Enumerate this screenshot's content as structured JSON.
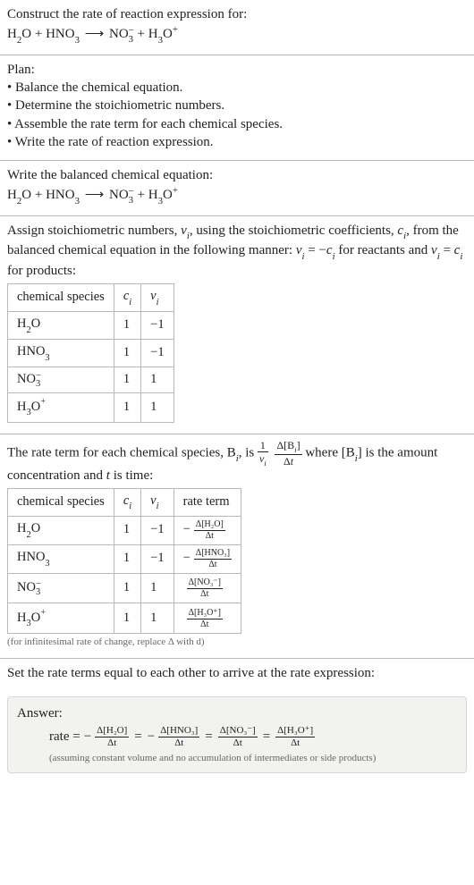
{
  "chart_data": [
    {
      "type": "table",
      "title": "Stoichiometric numbers",
      "columns": [
        "chemical species",
        "c_i",
        "ν_i"
      ],
      "rows": [
        [
          "H₂O",
          1,
          -1
        ],
        [
          "HNO₃",
          1,
          -1
        ],
        [
          "NO₃⁻",
          1,
          1
        ],
        [
          "H₃O⁺",
          1,
          1
        ]
      ]
    },
    {
      "type": "table",
      "title": "Rate terms",
      "columns": [
        "chemical species",
        "c_i",
        "ν_i",
        "rate term"
      ],
      "rows": [
        [
          "H₂O",
          1,
          -1,
          "−Δ[H₂O]/Δt"
        ],
        [
          "HNO₃",
          1,
          -1,
          "−Δ[HNO₃]/Δt"
        ],
        [
          "NO₃⁻",
          1,
          1,
          "Δ[NO₃⁻]/Δt"
        ],
        [
          "H₃O⁺",
          1,
          1,
          "Δ[H₃O⁺]/Δt"
        ]
      ]
    }
  ],
  "prompt": {
    "title": "Construct the rate of reaction expression for:"
  },
  "eq_parts": {
    "h2o": "H",
    "h2o_sub": "2",
    "h2o_o": "O",
    "plus": " + ",
    "hno3": "HNO",
    "hno3_sub": "3",
    "arrow": "⟶",
    "no3": "NO",
    "no3_sub": "3",
    "no3_sup": "−",
    "h3o": "H",
    "h3o_sub": "3",
    "h3o_o": "O",
    "h3o_sup": "+"
  },
  "plan": {
    "title": "Plan:",
    "b1": "• Balance the chemical equation.",
    "b2": "• Determine the stoichiometric numbers.",
    "b3": "• Assemble the rate term for each chemical species.",
    "b4": "• Write the rate of reaction expression."
  },
  "balanced": {
    "title": "Write the balanced chemical equation:"
  },
  "stoich": {
    "text_a": "Assign stoichiometric numbers, ",
    "nu_i": "ν",
    "nu_sub": "i",
    "text_b": ", using the stoichiometric coefficients, ",
    "c_i": "c",
    "c_sub": "i",
    "text_c": ", from the balanced chemical equation in the following manner: ",
    "rel1_a": "ν",
    "rel1_b": " = −",
    "rel1_c": "c",
    "text_d": " for reactants and ",
    "rel2_a": "ν",
    "rel2_b": " = ",
    "rel2_c": "c",
    "text_e": " for products:"
  },
  "table1": {
    "h1": "chemical species",
    "h2_a": "c",
    "h2_b": "i",
    "h3_a": "ν",
    "h3_b": "i",
    "r1": {
      "c": "1",
      "v": "−1"
    },
    "r2": {
      "c": "1",
      "v": "−1"
    },
    "r3": {
      "c": "1",
      "v": "1"
    },
    "r4": {
      "c": "1",
      "v": "1"
    }
  },
  "rateterm": {
    "text_a": "The rate term for each chemical species, B",
    "i": "i",
    "text_b": ", is ",
    "one": "1",
    "nu": "ν",
    "dB": "Δ[B",
    "dB2": "]",
    "dt": "Δt",
    "text_c": " where [B",
    "text_d": "] is the amount concentration and ",
    "t": "t",
    "text_e": " is time:"
  },
  "table2": {
    "h1": "chemical species",
    "h2_a": "c",
    "h2_b": "i",
    "h3_a": "ν",
    "h3_b": "i",
    "h4": "rate term",
    "r1": {
      "c": "1",
      "v": "−1",
      "num": "Δ[H₂O]",
      "den": "Δt",
      "neg": "− "
    },
    "r2": {
      "c": "1",
      "v": "−1",
      "num": "Δ[HNO₃]",
      "den": "Δt",
      "neg": "− "
    },
    "r3": {
      "c": "1",
      "v": "1",
      "num": "Δ[NO₃⁻]",
      "den": "Δt",
      "neg": ""
    },
    "r4": {
      "c": "1",
      "v": "1",
      "num": "Δ[H₃O⁺]",
      "den": "Δt",
      "neg": ""
    },
    "footnote": "(for infinitesimal rate of change, replace Δ with d)"
  },
  "final": {
    "title": "Set the rate terms equal to each other to arrive at the rate expression:"
  },
  "answer": {
    "title": "Answer:",
    "rate": "rate = ",
    "neg": "− ",
    "eq": " = ",
    "t1n": "Δ[H₂O]",
    "t1d": "Δt",
    "t2n": "Δ[HNO₃]",
    "t2d": "Δt",
    "t3n": "Δ[NO₃⁻]",
    "t3d": "Δt",
    "t4n": "Δ[H₃O⁺]",
    "t4d": "Δt",
    "assume": "(assuming constant volume and no accumulation of intermediates or side products)"
  }
}
